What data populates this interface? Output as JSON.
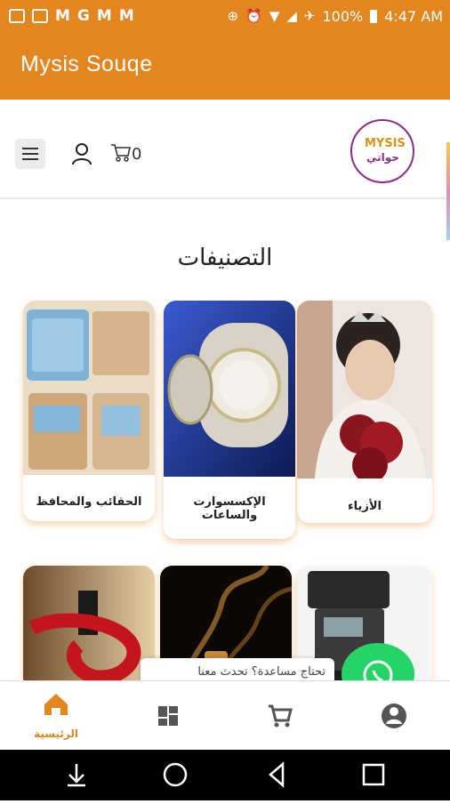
{
  "status_bar": {
    "notif_icons": [
      "message-icon",
      "square-icon",
      "gmail-icon",
      "g-icon",
      "gmail-icon",
      "gmail-icon"
    ],
    "battery": "100%",
    "time": "4:47 AM"
  },
  "app_bar": {
    "title": "Mysis Souqe"
  },
  "header": {
    "cart_count": "0",
    "logo_text_en": "MYSIS",
    "logo_text_ar": "حواتي"
  },
  "section": {
    "title": "التصنيفات"
  },
  "categories": [
    {
      "label": "الأزياء",
      "image": "bride-photo"
    },
    {
      "label": "الإكسسوارت والساعات",
      "image": "diamond-watch-photo"
    },
    {
      "label": "الحقائب والمحافظ",
      "image": "wallets-photo"
    },
    {
      "label": "",
      "image": "camera-flash-photo"
    },
    {
      "label": "",
      "image": "perfume-smoke-photo"
    },
    {
      "label": "",
      "image": "lipstick-photo"
    }
  ],
  "chat_prompt": "تحتاج مساعدة؟ تحدث معنا",
  "bottom_nav": {
    "items": [
      {
        "label": "الرئيسية",
        "icon": "home-icon",
        "active": true
      },
      {
        "label": "",
        "icon": "categories-icon",
        "active": false
      },
      {
        "label": "",
        "icon": "cart-icon",
        "active": false
      },
      {
        "label": "",
        "icon": "account-icon",
        "active": false
      }
    ]
  },
  "colors": {
    "primary": "#e38620",
    "logo_purple": "#8b2c86",
    "whatsapp": "#25d366"
  }
}
